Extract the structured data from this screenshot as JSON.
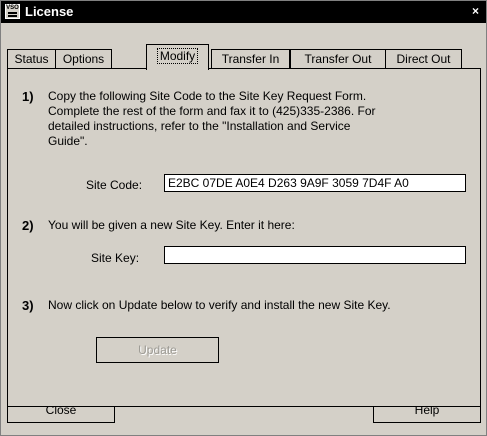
{
  "window": {
    "title": "License",
    "close_glyph": "×"
  },
  "icon": {
    "name": "license-app-icon",
    "glyph": "VSO"
  },
  "tabs": [
    {
      "label": "Status",
      "active": false
    },
    {
      "label": "Options",
      "active": false
    },
    {
      "label": "Modify",
      "active": true
    },
    {
      "label": "Transfer In",
      "active": false
    },
    {
      "label": "Transfer Out",
      "active": false
    },
    {
      "label": "Direct Out",
      "active": false
    }
  ],
  "steps": {
    "step1": {
      "number": "1)",
      "lines": [
        "Copy the following Site Code to the Site Key Request Form.",
        "Complete the rest of the form and fax it to (425)335-2386.  For",
        "detailed instructions, refer to the \"Installation and Service",
        "Guide\"."
      ],
      "site_code_label": "Site Code:",
      "site_code_value": "E2BC 07DE A0E4 D263 9A9F 3059 7D4F A0"
    },
    "step2": {
      "number": "2)",
      "text": "You will be given a new Site Key.  Enter it here:",
      "site_key_label": "Site Key:",
      "site_key_value": ""
    },
    "step3": {
      "number": "3)",
      "text": "Now click on Update below to verify and install the new Site Key.",
      "update_label": "Update"
    }
  },
  "footer": {
    "close_label": "Close",
    "help_label": "Help"
  }
}
